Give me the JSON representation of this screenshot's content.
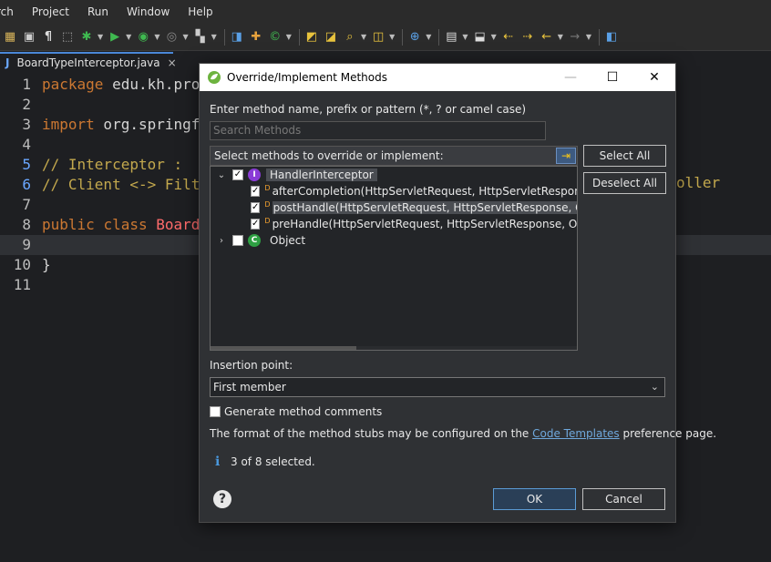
{
  "menubar": {
    "items": [
      "rch",
      "Project",
      "Run",
      "Window",
      "Help"
    ]
  },
  "editor": {
    "tab_icon": "J",
    "tab_name": "BoardTypeInterceptor.java",
    "tab_close": "×",
    "lines": [
      {
        "num": "1",
        "parts": [
          {
            "t": "package",
            "c": "kw"
          },
          {
            "t": " edu.kh.pro",
            "c": "pl"
          }
        ]
      },
      {
        "num": "2",
        "parts": []
      },
      {
        "num": "3",
        "parts": [
          {
            "t": "import",
            "c": "kw"
          },
          {
            "t": " org.springf",
            "c": "pl"
          }
        ]
      },
      {
        "num": "4",
        "parts": []
      },
      {
        "num": "5",
        "parts": [
          {
            "t": "// Interceptor : ",
            "c": "cm"
          }
        ]
      },
      {
        "num": "6",
        "parts": [
          {
            "t": "// Client <-> Filt",
            "c": "cm"
          }
        ]
      },
      {
        "num": "7",
        "parts": []
      },
      {
        "num": "8",
        "parts": [
          {
            "t": "public",
            "c": "kw"
          },
          {
            "t": " ",
            "c": "pl"
          },
          {
            "t": "class",
            "c": "kw"
          },
          {
            "t": " ",
            "c": "pl"
          },
          {
            "t": "Board",
            "c": "cls"
          }
        ]
      },
      {
        "num": "9",
        "parts": []
      },
      {
        "num": "10",
        "parts": [
          {
            "t": "}",
            "c": "pl"
          }
        ]
      },
      {
        "num": "11",
        "parts": []
      }
    ],
    "right_fragment": "oller"
  },
  "dialog": {
    "title": "Override/Implement Methods",
    "minimize": "—",
    "maximize": "☐",
    "close": "✕",
    "search_label": "Enter method name, prefix or pattern (*, ? or camel case)",
    "search_placeholder": "Search Methods",
    "tree_header": "Select methods to override or implement:",
    "tree": [
      {
        "label": "HandlerInterceptor",
        "twisty": "⌄",
        "checked": true,
        "badge": "I",
        "badge_color": "#8a3bd6",
        "selected": true
      },
      {
        "label": "afterCompletion(HttpServletRequest, HttpServletResponse, Obj",
        "checked": true
      },
      {
        "label": "postHandle(HttpServletRequest, HttpServletResponse, Obje",
        "checked": true,
        "selected": true
      },
      {
        "label": "preHandle(HttpServletRequest, HttpServletResponse, Object",
        "checked": true
      },
      {
        "label": "Object",
        "twisty": "›",
        "checked": false,
        "badge": "C",
        "badge_color": "#2ea043"
      }
    ],
    "select_all": "Select All",
    "deselect_all": "Deselect All",
    "insertion_label": "Insertion point:",
    "insertion_value": "First member",
    "generate_comments": "Generate method comments",
    "format_prefix": "The format of the method stubs may be configured on the ",
    "format_link": "Code Templates",
    "format_suffix": " preference page.",
    "status": "3 of 8 selected.",
    "ok": "OK",
    "cancel": "Cancel"
  }
}
